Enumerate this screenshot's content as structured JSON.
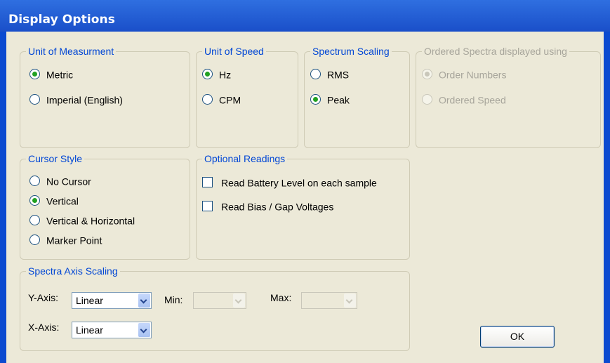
{
  "window": {
    "title": "Display Options"
  },
  "unit_measurement": {
    "legend": "Unit of Measurment",
    "options": [
      "Metric",
      "Imperial (English)"
    ],
    "selected": "Metric"
  },
  "unit_speed": {
    "legend": "Unit of Speed",
    "options": [
      "Hz",
      "CPM"
    ],
    "selected": "Hz"
  },
  "spectrum_scaling": {
    "legend": "Spectrum Scaling",
    "options": [
      "RMS",
      "Peak"
    ],
    "selected": "Peak"
  },
  "ordered_spectra": {
    "legend": "Ordered Spectra displayed using",
    "options": [
      "Order Numbers",
      "Ordered Speed"
    ],
    "selected": "Order Numbers",
    "enabled": false
  },
  "cursor_style": {
    "legend": "Cursor Style",
    "options": [
      "No Cursor",
      "Vertical",
      "Vertical & Horizontal",
      "Marker Point"
    ],
    "selected": "Vertical"
  },
  "optional_readings": {
    "legend": "Optional Readings",
    "items": [
      {
        "label": "Read Battery Level on each sample",
        "checked": false
      },
      {
        "label": "Read Bias / Gap Voltages",
        "checked": false
      }
    ]
  },
  "axis_scaling": {
    "legend": "Spectra Axis Scaling",
    "y_label": "Y-Axis:",
    "y_value": "Linear",
    "x_label": "X-Axis:",
    "x_value": "Linear",
    "min_label": "Min:",
    "min_value": "",
    "max_label": "Max:",
    "max_value": ""
  },
  "buttons": {
    "ok": "OK"
  },
  "colors": {
    "title_bar": "#1a4fc9",
    "dialog_bg": "#ece9d8",
    "group_title": "#0046d5",
    "disabled_text": "#a7a59b",
    "radio_dot": "#21a121"
  }
}
